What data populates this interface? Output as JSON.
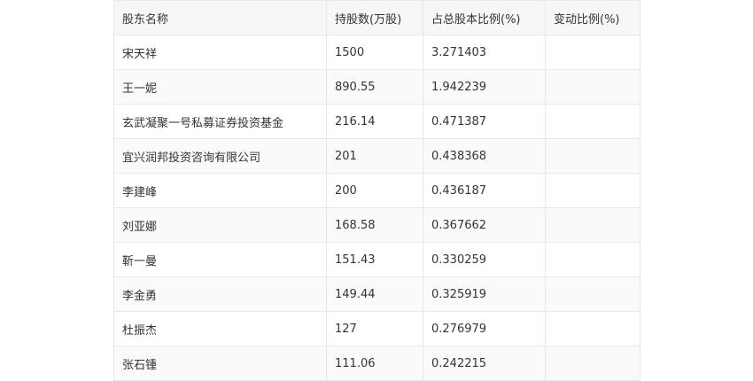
{
  "table": {
    "headers": [
      "股东名称",
      "持股数(万股)",
      "占总股本比例(%)",
      "变动比例(%)"
    ],
    "rows": [
      [
        "宋天祥",
        "1500",
        "3.271403",
        ""
      ],
      [
        "王一妮",
        "890.55",
        "1.942239",
        ""
      ],
      [
        "玄武凝聚一号私募证券投资基金",
        "216.14",
        "0.471387",
        ""
      ],
      [
        "宜兴润邦投资咨询有限公司",
        "201",
        "0.438368",
        ""
      ],
      [
        "李建峰",
        "200",
        "0.436187",
        ""
      ],
      [
        "刘亚娜",
        "168.58",
        "0.367662",
        ""
      ],
      [
        "靳一曼",
        "151.43",
        "0.330259",
        ""
      ],
      [
        "李金勇",
        "149.44",
        "0.325919",
        ""
      ],
      [
        "杜振杰",
        "127",
        "0.276979",
        ""
      ],
      [
        "张石锺",
        "111.06",
        "0.242215",
        ""
      ]
    ]
  }
}
